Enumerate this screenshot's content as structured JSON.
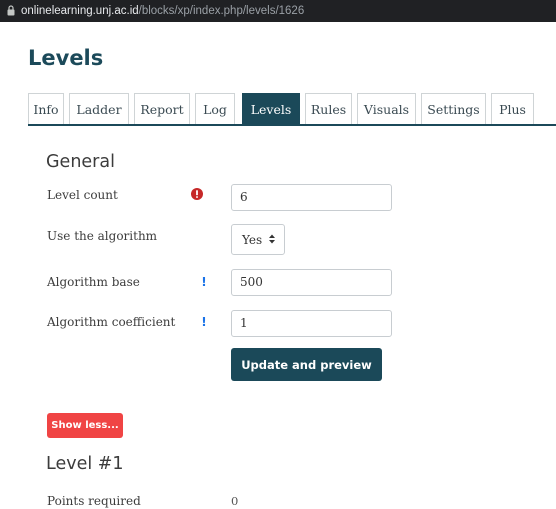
{
  "browser": {
    "url_host": "onlinelearning.unj.ac.id",
    "url_path": "/blocks/xp/index.php/levels/1626"
  },
  "page": {
    "title": "Levels"
  },
  "tabs": [
    {
      "label": "Info",
      "active": false
    },
    {
      "label": "Ladder",
      "active": false
    },
    {
      "label": "Report",
      "active": false
    },
    {
      "label": "Log",
      "active": false
    },
    {
      "label": "Levels",
      "active": true
    },
    {
      "label": "Rules",
      "active": false
    },
    {
      "label": "Visuals",
      "active": false
    },
    {
      "label": "Settings",
      "active": false
    },
    {
      "label": "Plus",
      "active": false
    }
  ],
  "general": {
    "heading": "General",
    "level_count": {
      "label": "Level count",
      "value": "6",
      "icon": "required-exclamation-icon"
    },
    "use_algorithm": {
      "label": "Use the algorithm",
      "value": "Yes"
    },
    "algorithm_base": {
      "label": "Algorithm base",
      "value": "500",
      "icon": "help-icon"
    },
    "algorithm_coefficient": {
      "label": "Algorithm coefficient",
      "value": "1",
      "icon": "help-icon"
    },
    "update_button": "Update and preview"
  },
  "show_less_button": "Show less...",
  "level1": {
    "heading": "Level #1",
    "points_required": {
      "label": "Points required",
      "value": "0"
    }
  },
  "colors": {
    "brand": "#1b4959",
    "danger": "#f04444",
    "required": "#c62828",
    "help": "#1a73e8"
  }
}
